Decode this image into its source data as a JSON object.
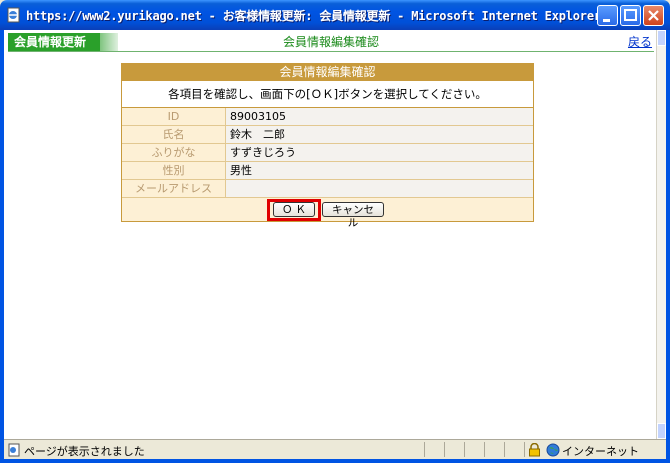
{
  "window": {
    "title": "https://www2.yurikago.net - お客様情報更新: 会員情報更新 - Microsoft Internet Explorer"
  },
  "header": {
    "section_label": "会員情報更新",
    "page_title": "会員情報編集確認",
    "back_link": "戻る"
  },
  "form": {
    "title": "会員情報編集確認",
    "instruction": "各項目を確認し、画面下の[ＯＫ]ボタンを選択してください。",
    "fields": [
      {
        "label": "ID",
        "value": "89003105"
      },
      {
        "label": "氏名",
        "value": "鈴木　二郎"
      },
      {
        "label": "ふりがな",
        "value": "すずきじろう"
      },
      {
        "label": "性別",
        "value": "男性"
      },
      {
        "label": "メールアドレス",
        "value": ""
      }
    ],
    "ok_label": "Ｏ Ｋ",
    "cancel_label": "キャンセル"
  },
  "statusbar": {
    "status_text": "ページが表示されました",
    "zone_text": "インターネット"
  },
  "colors": {
    "accent_green": "#2aa02a",
    "form_header": "#c89a3c",
    "highlight": "#e00000"
  },
  "icons": {
    "app": "ie-page-icon",
    "status": "ie-page-icon",
    "lock": "lock-icon",
    "zone": "globe-icon"
  }
}
